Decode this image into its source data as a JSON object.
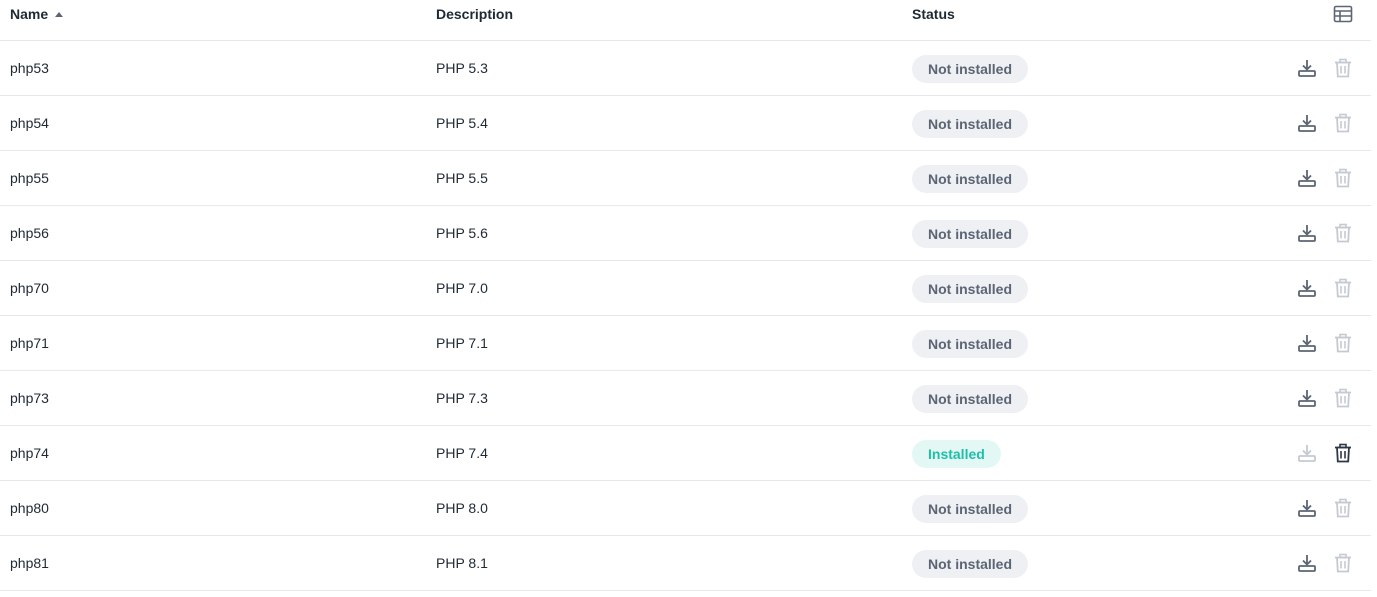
{
  "table": {
    "headers": {
      "name": "Name",
      "description": "Description",
      "status": "Status"
    },
    "sort": {
      "column": "name",
      "direction": "ascending"
    },
    "rows": [
      {
        "name": "php53",
        "description": "PHP 5.3",
        "status": "Not installed",
        "installed": false
      },
      {
        "name": "php54",
        "description": "PHP 5.4",
        "status": "Not installed",
        "installed": false
      },
      {
        "name": "php55",
        "description": "PHP 5.5",
        "status": "Not installed",
        "installed": false
      },
      {
        "name": "php56",
        "description": "PHP 5.6",
        "status": "Not installed",
        "installed": false
      },
      {
        "name": "php70",
        "description": "PHP 7.0",
        "status": "Not installed",
        "installed": false
      },
      {
        "name": "php71",
        "description": "PHP 7.1",
        "status": "Not installed",
        "installed": false
      },
      {
        "name": "php73",
        "description": "PHP 7.3",
        "status": "Not installed",
        "installed": false
      },
      {
        "name": "php74",
        "description": "PHP 7.4",
        "status": "Installed",
        "installed": true
      },
      {
        "name": "php80",
        "description": "PHP 8.0",
        "status": "Not installed",
        "installed": false
      },
      {
        "name": "php81",
        "description": "PHP 8.1",
        "status": "Not installed",
        "installed": false
      }
    ]
  },
  "icons": {
    "columns": "table-columns-icon",
    "install": "download-icon",
    "uninstall": "trash-icon"
  },
  "colors": {
    "icon_active": "#5b6573",
    "icon_disabled": "#c5cad2",
    "icon_strong": "#2d3748",
    "installed_text": "#1fbfa7",
    "installed_bg": "#e3f8f4",
    "not_installed_text": "#5b6573",
    "not_installed_bg": "#eef0f4"
  }
}
